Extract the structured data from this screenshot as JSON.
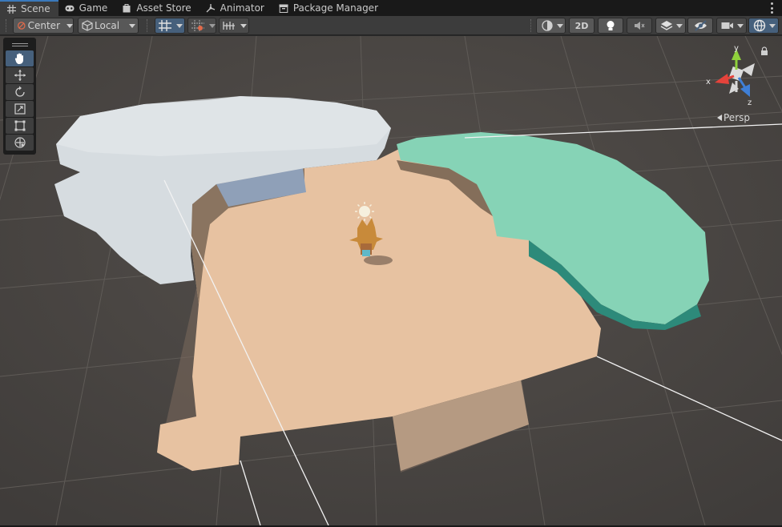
{
  "tabs": [
    {
      "label": "Scene",
      "icon": "hash-grid-icon",
      "active": true
    },
    {
      "label": "Game",
      "icon": "gamepad-icon",
      "active": false
    },
    {
      "label": "Asset Store",
      "icon": "shopping-bag-icon",
      "active": false
    },
    {
      "label": "Animator",
      "icon": "animator-icon",
      "active": false
    },
    {
      "label": "Package Manager",
      "icon": "package-icon",
      "active": false
    }
  ],
  "toolbar": {
    "pivot_mode": "Center",
    "pivot_rotation": "Local",
    "mode_2d": "2D",
    "icons": [
      "grid-snap-icon",
      "snap-increment-icon",
      "ruler-icon",
      "draw-mode-icon",
      "lighting-icon",
      "audio-mute-icon",
      "effects-icon",
      "hidden-objects-icon",
      "camera-icon",
      "gizmos-icon"
    ]
  },
  "tool_palette": [
    "hand-tool-icon",
    "move-tool-icon",
    "rotate-tool-icon",
    "scale-tool-icon",
    "rect-tool-icon",
    "transform-tool-icon"
  ],
  "gizmo": {
    "x": "x",
    "y": "y",
    "z": "z",
    "projection": "Persp"
  },
  "colors": {
    "accent": "#3a79bb",
    "ground": "#e9c3a3",
    "snow": "#d8dde1",
    "grass": "#86d3b6",
    "axis_x": "#e5433b",
    "axis_y": "#8fd13b",
    "axis_z": "#3f7fd6"
  }
}
